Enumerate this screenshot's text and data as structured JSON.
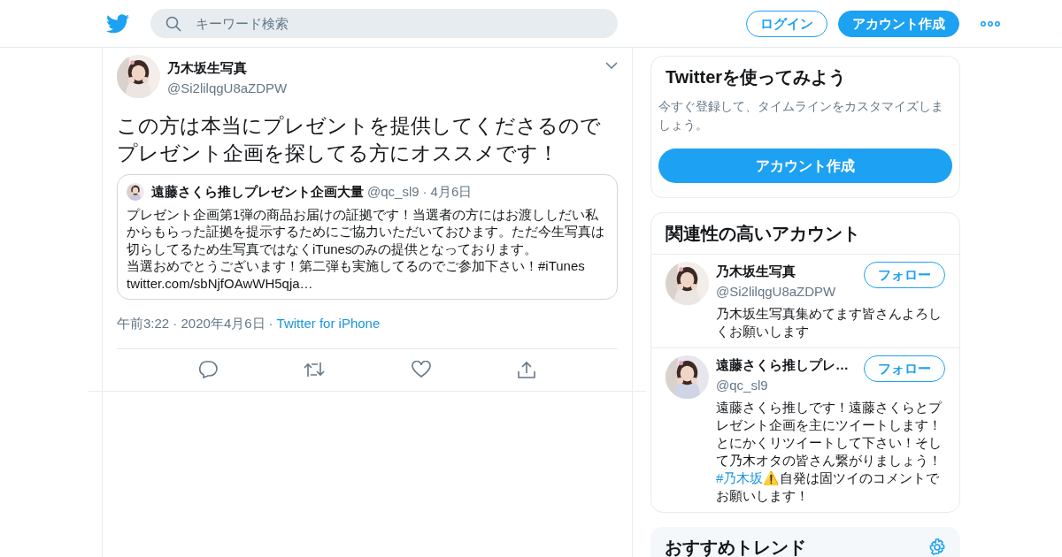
{
  "header": {
    "search": {
      "placeholder": "キーワード検索"
    },
    "login_button": "ログイン",
    "signup_button": "アカウント作成"
  },
  "tweet": {
    "author": {
      "name": "乃木坂生写真",
      "handle": "@Si2lilqgU8aZDPW"
    },
    "text": "この方は本当にプレゼントを提供してくださるのでプレゼント企画を探してる方にオススメです！",
    "quote": {
      "author": "遠藤さくら推しプレゼント企画大量",
      "handle": "@qc_sl9",
      "separator": "·",
      "date": "4月6日",
      "lines": [
        "プレゼント企画第1弾の商品お届けの証拠です！当選者の方にはお渡ししだい私からもらった証拠を提示するためにご協力いただいておひます。ただ今生写真は切らしてるため生写真ではなくiTunesのみの提供となっております。",
        "当選おめでとうございます！第二弾も実施してるのでご参加下さい！#iTunes",
        "twitter.com/sbNjfOAwWH5qja…"
      ]
    },
    "time": "午前3:22 · 2020年4月6日",
    "separator": "·",
    "source": "Twitter for iPhone"
  },
  "signup_card": {
    "title": "Twitterを使ってみよう",
    "text": "今すぐ登録して、タイムラインをカスタマイズしましょう。",
    "button": "アカウント作成"
  },
  "related": {
    "title": "関連性の高いアカウント",
    "accounts": [
      {
        "name": "乃木坂生写真",
        "handle": "@Si2lilqgU8aZDPW",
        "follow": "フォロー",
        "bio": [
          {
            "kind": "text",
            "text": "乃木坂生写真集めてます皆さんよろしくお願いします"
          }
        ]
      },
      {
        "name": "遠藤さくら推しプレ…",
        "handle": "@qc_sl9",
        "follow": "フォロー",
        "bio": [
          {
            "kind": "text",
            "text": "遠藤さくら推しです！遠藤さくらとプレゼント企画を主にツイートします！とにかくリツイートして下さい！そして乃木オタの皆さん繋がりましょう！"
          },
          {
            "kind": "hashtag",
            "text": "#乃木坂"
          },
          {
            "kind": "text",
            "text": "⚠️自発は固ツイのコメントでお願いします！"
          }
        ]
      }
    ]
  },
  "trends": {
    "title": "おすすめトレンド"
  }
}
